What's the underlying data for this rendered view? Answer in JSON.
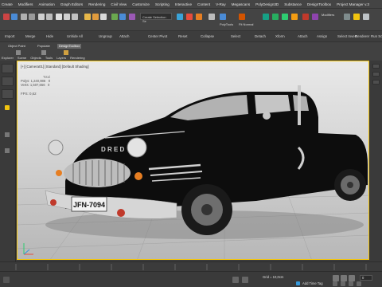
{
  "menu": [
    "Create",
    "Modifiers",
    "Animation",
    "Graph Editors",
    "Rendering",
    "Civil View",
    "Customize",
    "Scripting",
    "Interactive",
    "Content",
    "V-Ray",
    "Megascans",
    "PolyDesign3D",
    "Substance",
    "DesignToolbox",
    "Project Manager v.3"
  ],
  "toolbar": {
    "selection_filter": "Create Selection Se",
    "coord_label": "View",
    "polytools": "PolyTools",
    "fit_normal": "Fit Normal",
    "modifiers_label": "Modifiers"
  },
  "toolbar2": [
    "Import",
    "Merge",
    "Hide",
    "Unhide All",
    "Ungroup",
    "Attach",
    "Center Pivot",
    "Reset",
    "Collapse",
    "Select",
    "Detach",
    "Xform",
    "Attach",
    "Assign",
    "Select Invert",
    "Renderer",
    "Run Script",
    "EXR"
  ],
  "panel_tabs": {
    "object_paint": "Object Paint",
    "populate": "Populate",
    "design_toolbox": "DesignToolbox"
  },
  "ribbon_tabs": [
    "Explorer",
    "Scene",
    "Objects",
    "Tools",
    "Layers",
    "Rendering"
  ],
  "viewport": {
    "label": "[+] [Camera01] [Standard] [Default Shading]",
    "stats_header": "Total",
    "polys_label": "Polys:",
    "polys_value": "1,240,986",
    "verts_label": "Verts:",
    "verts_value": "1,507,656",
    "polys_sel": "0",
    "verts_sel": "0",
    "fps_label": "FPS:",
    "fps_value": "0,62",
    "plate_text": "JFN-7094",
    "hood_text": "D R E D"
  },
  "status": {
    "grid": "Grid = 10,0cm",
    "add_time_tag": "Add Time Tag",
    "frame": "0"
  },
  "colors": {
    "accent": "#f1c40f",
    "bg": "#3a3a3a"
  }
}
